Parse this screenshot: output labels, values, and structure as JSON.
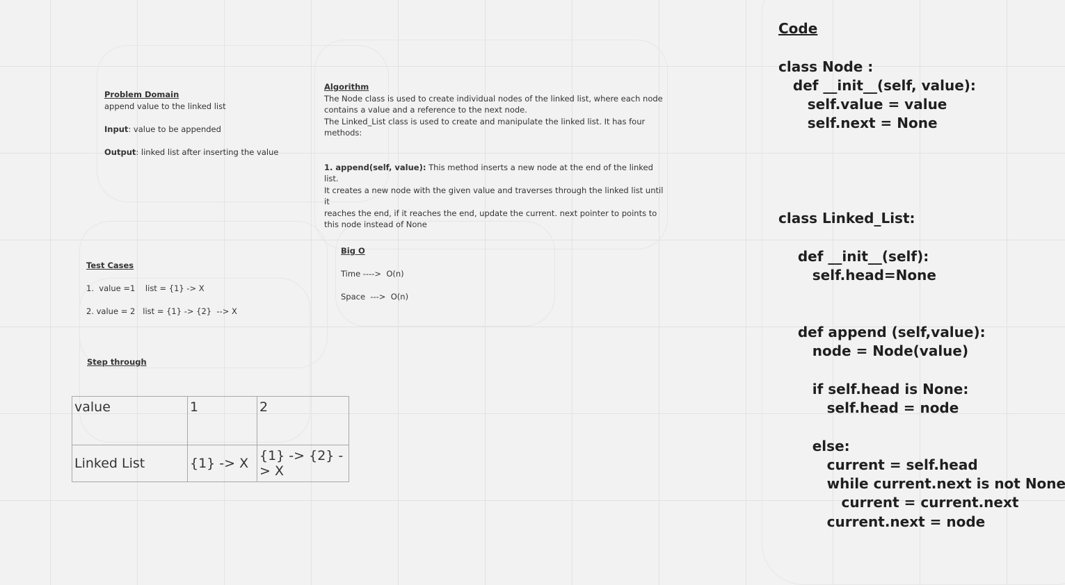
{
  "problem_domain": {
    "title": "Problem Domain",
    "description": "append value to the linked list",
    "input_label": "Input",
    "input_text": ": value to be appended",
    "output_label": "Output",
    "output_text": ": linked list after inserting the value"
  },
  "algorithm": {
    "title": "Algorithm",
    "lines": [
      "The Node class is used to create individual nodes of the linked list, where each node",
      "contains a value and a reference to the next node.",
      "The Linked_List class is used to create and manipulate the linked list. It has four",
      "methods:"
    ],
    "method_label": "1. append(self, value):",
    "method_lines": [
      " This method inserts a new node at the end of the linked list.",
      "It creates a new node with the given value and traverses through the linked list until it",
      "reaches the end, if it reaches the end, update the current. next pointer to points to",
      "this node instead of None"
    ]
  },
  "test_cases": {
    "title": "Test Cases",
    "cases": [
      "1.  value =1    list = {1} -> X",
      "2. value = 2   list = {1} -> {2}  --> X"
    ]
  },
  "big_o": {
    "title": "Big O",
    "time": "Time ---->  O(n)",
    "space": "Space  --->  O(n)"
  },
  "step_through": {
    "title": "Step through",
    "rows": [
      [
        "value",
        "1",
        "2"
      ],
      [
        "Linked List",
        "{1} -> X",
        "{1} -> {2} -> X"
      ]
    ]
  },
  "code": {
    "title": "Code",
    "lines": [
      "",
      "class Node :",
      "   def __init__(self, value):",
      "      self.value = value",
      "      self.next = None",
      "",
      "",
      "",
      "",
      "class Linked_List:",
      "",
      "    def __init__(self):",
      "       self.head=None",
      "",
      "",
      "    def append (self,value):",
      "       node = Node(value)",
      "",
      "       if self.head is None:",
      "          self.head = node",
      "",
      "       else:",
      "          current = self.head",
      "          while current.next is not None:",
      "             current = current.next",
      "          current.next = node"
    ]
  }
}
